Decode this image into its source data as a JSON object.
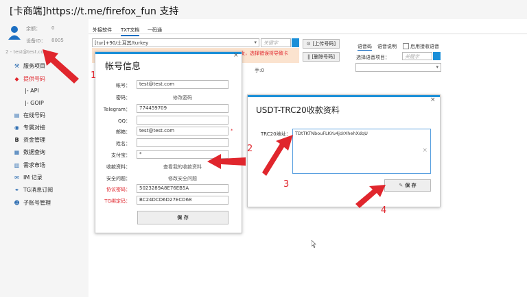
{
  "app": {
    "title": "[卡商端]https://t.me/firefox_fun 支持"
  },
  "sidebar": {
    "balance_label": "余额：",
    "balance_value": "0",
    "device_label": "设备ID：",
    "device_value": "8005",
    "account": "2 - test@test.com",
    "items": [
      {
        "label": "服务项目",
        "icon": "service-icon"
      },
      {
        "label": "提供号码",
        "icon": "number-icon"
      },
      {
        "label": "|- API",
        "icon": ""
      },
      {
        "label": "|- GOIP",
        "icon": ""
      },
      {
        "label": "在线号码",
        "icon": "online-number-icon"
      },
      {
        "label": "专属对接",
        "icon": "dock-icon"
      },
      {
        "label": "资金管理",
        "icon": "funds-icon"
      },
      {
        "label": "数据查询",
        "icon": "data-query-icon"
      },
      {
        "label": "需求市场",
        "icon": "market-icon"
      },
      {
        "label": "IM 记录",
        "icon": "im-icon"
      },
      {
        "label": "TG消息订阅",
        "icon": "subscribe-icon"
      },
      {
        "label": "子账号管理",
        "icon": "sub-account-icon"
      }
    ]
  },
  "main": {
    "tabs": [
      "外接软件",
      "TXT文档",
      "一码通"
    ],
    "country_select": "[tur]+90/土耳其/turkey",
    "keyword_placeholder": "关键字",
    "upload_btn": "[上传号码]",
    "delete_btn": "[删除号码]",
    "warning": "发，选择错误将导致卡",
    "hand_label": "手:0",
    "voice_tabs": [
      "语音码",
      "语音说明"
    ],
    "voice_checkbox": "启用接收语音",
    "voice_select_label": "选择语音项目：",
    "voice_keyword_placeholder": "关键字"
  },
  "account_dialog": {
    "title": "帐号信息",
    "close": "×",
    "fields": [
      {
        "label": "帐号：",
        "value": "test@test.com",
        "type": "input"
      },
      {
        "label": "密码：",
        "value": "修改密码",
        "type": "link"
      },
      {
        "label": "Telegram：",
        "value": "774459709",
        "type": "input"
      },
      {
        "label": "QQ：",
        "value": "",
        "type": "input"
      },
      {
        "label": "邮箱：",
        "value": "test@test.com",
        "type": "input"
      },
      {
        "label": "姓名：",
        "value": "",
        "type": "input"
      },
      {
        "label": "支付宝：",
        "value": "*",
        "type": "input"
      },
      {
        "label": "收款资料：",
        "value": "查看我的收款资料",
        "type": "link"
      },
      {
        "label": "安全问题：",
        "value": "修改安全问题",
        "type": "link"
      },
      {
        "label": "协议密码：",
        "value": "5023289A8E76EB5A",
        "type": "input",
        "red": true
      },
      {
        "label": "TG绑定码：",
        "value": "BC24DCD6D27ECD68",
        "type": "input",
        "red": true
      }
    ],
    "required_mark": "*",
    "save_label": "保 存"
  },
  "usdt_dialog": {
    "title": "USDT-TRC20收款资料",
    "close": "×",
    "field_label": "TRC20地址：",
    "field_value": "TDtTKTNbouFLKYu4jdrXhehXdqU",
    "clear_icon": "×",
    "save_label": "保 存"
  },
  "annotations": [
    "1",
    "2",
    "3",
    "4"
  ],
  "colors": {
    "accent": "#1b8fd8",
    "annotation": "#e0262d",
    "link_active": "#e0262d"
  }
}
